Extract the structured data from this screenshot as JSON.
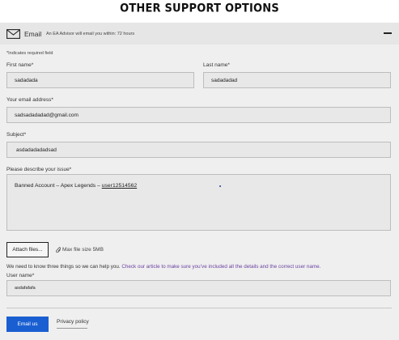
{
  "title": "OTHER SUPPORT OPTIONS",
  "email_section": {
    "label": "Email",
    "note": "An EA Advisor will email you within: 72 hours",
    "icon": "mail-icon",
    "collapse_icon": "minus-icon"
  },
  "form": {
    "required_note": "*Indicates required field",
    "first_name": {
      "label": "First name*",
      "value": "sadadada"
    },
    "last_name": {
      "label": "Last name*",
      "value": "sadadadad"
    },
    "email": {
      "label": "Your email address*",
      "value": "sadsadadadad@gmail.com"
    },
    "subject": {
      "label": "Subject*",
      "value": "asdadadadadsad"
    },
    "issue": {
      "label": "Please describe your issue*",
      "value_prefix": "Banned Account – Apex Legends – ",
      "value_link": "user12514562"
    },
    "attach_label": "Attach files...",
    "max_size": "Max file size 5MB",
    "info_text": "We need to know three things so we can help you.",
    "info_link": "Check our article to make sure you’ve included all the details and the correct user name.",
    "user_name": {
      "label": "User name*",
      "value": "asdafafafa"
    },
    "submit_label": "Email us",
    "privacy_label": "Privacy policy"
  },
  "colors": {
    "panel_bg": "#efefef",
    "header_bg": "#e6e6e6",
    "field_bg": "#e8e8e8",
    "primary": "#1a5fd1",
    "link": "#6a3fa0"
  }
}
